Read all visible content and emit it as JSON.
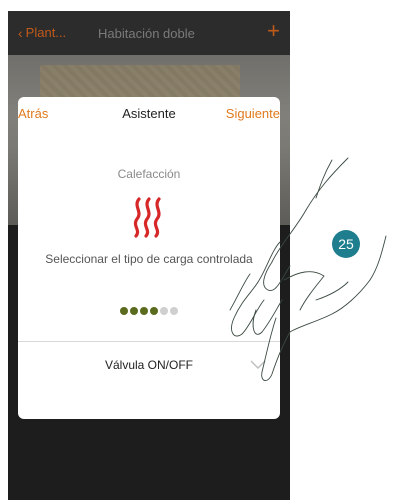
{
  "navbar": {
    "back_label": "Plant...",
    "title": "Habitación doble",
    "add_label": "+"
  },
  "dialog": {
    "back_label": "Atrás",
    "title": "Asistente",
    "next_label": "Siguiente",
    "category": "Calefacción",
    "category_icon": "heating-icon",
    "description": "Seleccionar el tipo de carga controlada",
    "steps_total": 6,
    "steps_completed": 4,
    "selected_value": "Válvula ON/OFF"
  },
  "callout": {
    "number": "25"
  },
  "colors": {
    "accent": "#e07a1e",
    "heat_icon": "#d62828",
    "dot_active": "#5a6b1e",
    "dot_inactive": "#cfcfcf",
    "badge": "#1e7e8e"
  }
}
